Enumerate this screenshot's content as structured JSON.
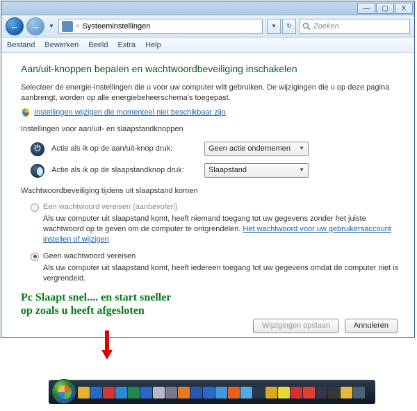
{
  "window": {
    "min": "—",
    "max": "▢",
    "close": "X"
  },
  "nav": {
    "back": "←",
    "fwd": "→",
    "drop": "▼",
    "path_sep": "«",
    "path_text": "Systeeminstellingen",
    "refresh": "↻",
    "search_placeholder": "Zoeken"
  },
  "menu": {
    "file": "Bestand",
    "edit": "Bewerken",
    "view": "Beeld",
    "extra": "Extra",
    "help": "Help"
  },
  "page": {
    "heading": "Aan/uit-knoppen bepalen en wachtwoordbeveiliging inschakelen",
    "intro": "Selecteer de energie-instellingen die u voor uw computer wilt gebruiken. De wijzigingen die u op deze pagina aanbrengt, worden op alle energiebeheerschema's toegepast.",
    "shield_link": "Instellingen wijzigen die momenteel niet beschikbaar zijn",
    "buttons_section": "Instellingen voor aan/uit- en slaapstandknoppen",
    "power_label": "Actie als ik op de aan/uit-knop druk:",
    "power_value": "Geen actie ondernemen",
    "sleep_label": "Actie als ik op de slaapstandknop druk:",
    "sleep_value": "Slaapstand",
    "pw_section": "Wachtwoordbeveiliging tijdens uit slaapstand komen",
    "radio1_label": "Een wachtwoord vereisen (aanbevolen)",
    "radio1_desc_a": "Als uw computer uit slaapstand komt, heeft niemand toegang tot uw gegevens zonder het juiste wachtwoord op te geven om de computer te ontgrendelen. ",
    "radio1_link": "Het wachtwoord voor uw gebruikersaccount instellen of wijzigen",
    "radio2_label": "Geen wachtwoord vereisen",
    "radio2_desc": "Als uw computer uit slaapstand komt, heeft iedereen toegang tot uw gegevens omdat de computer niet is vergrendeld.",
    "green_note_1": "Pc Slaapt snel.... en start sneller",
    "green_note_2": "op zoals u heeft afgesloten",
    "save_btn": "Wijzigingen opslaan",
    "cancel_btn": "Annuleren"
  },
  "taskbar_colors": [
    "#e8b030",
    "#2868c8",
    "#d03838",
    "#3088d0",
    "#208848",
    "#2868c8",
    "#b8b8c8",
    "#787888",
    "#e87828",
    "#2858b0",
    "#2868c8",
    "#4098e0",
    "#e86020",
    "#58a8e0",
    "#283848",
    "#d8a820",
    "#e8d838",
    "#d83030",
    "#e04030",
    "#303848",
    "#383838",
    "#e8b838",
    "#506070"
  ]
}
